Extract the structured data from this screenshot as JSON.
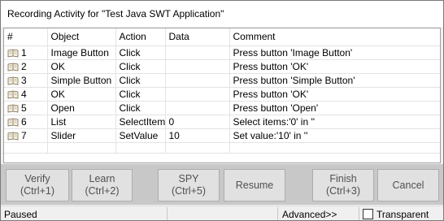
{
  "window": {
    "title": "Recording Activity for \"Test Java SWT Application\""
  },
  "grid": {
    "columns": [
      "#",
      "Object",
      "Action",
      "Data",
      "Comment"
    ],
    "rows": [
      {
        "num": "1",
        "object": "Image Button",
        "action": "Click",
        "data": "",
        "comment": "Press button 'Image Button'"
      },
      {
        "num": "2",
        "object": "OK",
        "action": "Click",
        "data": "",
        "comment": "Press button 'OK'"
      },
      {
        "num": "3",
        "object": "Simple Button",
        "action": "Click",
        "data": "",
        "comment": "Press button 'Simple Button'"
      },
      {
        "num": "4",
        "object": "OK",
        "action": "Click",
        "data": "",
        "comment": "Press button 'OK'"
      },
      {
        "num": "5",
        "object": "Open",
        "action": "Click",
        "data": "",
        "comment": "Press button 'Open'"
      },
      {
        "num": "6",
        "object": "List",
        "action": "SelectItem",
        "data": "0",
        "comment": "Select items:'0' in ''"
      },
      {
        "num": "7",
        "object": "Slider",
        "action": "SetValue",
        "data": "10",
        "comment": "Set value:'10' in ''"
      }
    ],
    "row_icon": "book-icon"
  },
  "buttons": {
    "verify": {
      "line1": "Verify",
      "line2": "(Ctrl+1)"
    },
    "learn": {
      "line1": "Learn",
      "line2": "(Ctrl+2)"
    },
    "spy": {
      "line1": "SPY",
      "line2": "(Ctrl+5)"
    },
    "resume": {
      "line1": "Resume"
    },
    "finish": {
      "line1": "Finish",
      "line2": "(Ctrl+3)"
    },
    "cancel": {
      "line1": "Cancel"
    }
  },
  "status": {
    "text": "Paused",
    "advanced_label": "Advanced>>",
    "transparent_label": "Transparent",
    "transparent_checked": false
  },
  "colors": {
    "button_bar_bg": "#c8c8c8",
    "button_face": "#e1e1e1",
    "button_text": "#505050"
  }
}
